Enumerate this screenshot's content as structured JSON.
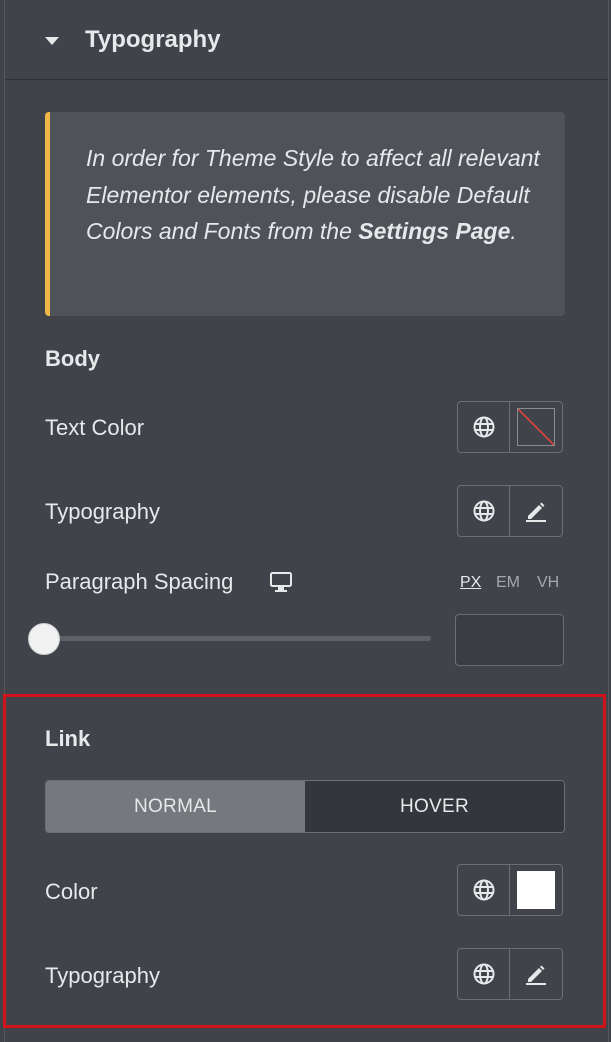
{
  "section": {
    "title": "Typography"
  },
  "notice": {
    "text_before": "In order for Theme Style to affect all relevant Elementor elements, please disable Default Colors and Fonts from the ",
    "link_text": "Settings Page",
    "text_after": "."
  },
  "body": {
    "heading": "Body",
    "text_color_label": "Text Color",
    "typography_label": "Typography",
    "paragraph_spacing_label": "Paragraph Spacing",
    "units": [
      "PX",
      "EM",
      "VH"
    ],
    "active_unit": "PX",
    "paragraph_spacing_value": "",
    "slider_level": 0
  },
  "link": {
    "heading": "Link",
    "tabs": [
      "NORMAL",
      "HOVER"
    ],
    "active_tab": "NORMAL",
    "color_label": "Color",
    "color_value": "#ffffff",
    "typography_label": "Typography"
  },
  "colors": {
    "panel_bg": "#404349",
    "notice_accent": "#f0b849",
    "highlight": "#d1121b"
  }
}
